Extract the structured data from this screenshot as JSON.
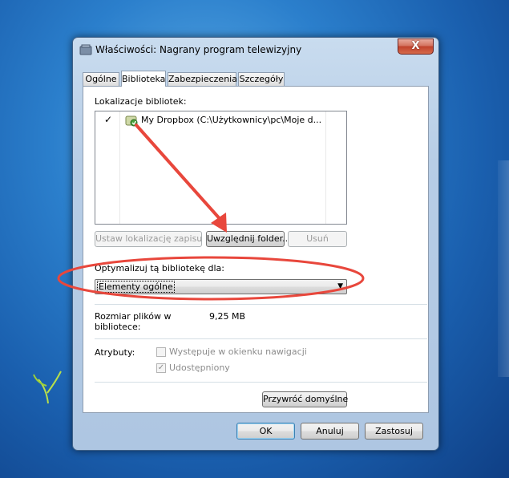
{
  "window": {
    "title": "Właściwości: Nagrany program telewizyjny",
    "close_glyph": "X"
  },
  "tabs": [
    {
      "label": "Ogólne",
      "active": false
    },
    {
      "label": "Biblioteka",
      "active": true
    },
    {
      "label": "Zabezpieczenia",
      "active": false
    },
    {
      "label": "Szczegóły",
      "active": false
    }
  ],
  "library": {
    "section_label": "Lokalizacje bibliotek:",
    "items": [
      {
        "check": "✓",
        "text": "My Dropbox (C:\\Użytkownicy\\pc\\Moje d..."
      }
    ],
    "set_save_location_label": "Ustaw lokalizację zapisu",
    "include_folder_label": "Uwzględnij folder...",
    "remove_label": "Usuń"
  },
  "optimize": {
    "label": "Optymalizuj tą bibliotekę dla:",
    "selected": "Elementy ogólne"
  },
  "size": {
    "label_line1": "Rozmiar plików w",
    "label_line2": "bibliotece:",
    "value": "9,25 MB"
  },
  "attributes": {
    "label": "Atrybuty:",
    "nav_label": "Występuje w okienku nawigacji",
    "nav_checked": false,
    "shared_label": "Udostępniony",
    "shared_checked": true,
    "restore_defaults_label": "Przywróć domyślne"
  },
  "footer": {
    "ok_label": "OK",
    "cancel_label": "Anuluj",
    "apply_label": "Zastosuj"
  },
  "colors": {
    "annotation": "#e8473c",
    "desktop": "#2b7fcc"
  }
}
